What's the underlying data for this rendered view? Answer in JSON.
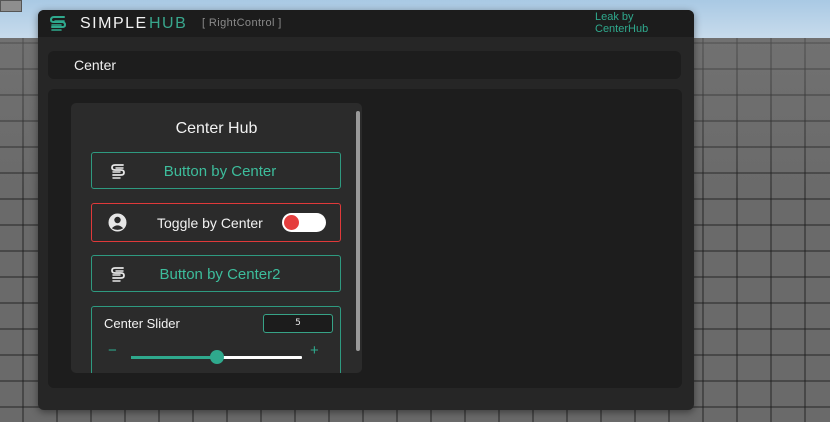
{
  "app": {
    "title_part1": "SIMPLE",
    "title_part2": "HUB",
    "keybind_hint": "[ RightControl ]",
    "credit_line1": "Leak by",
    "credit_line2": "CenterHub"
  },
  "tabs": [
    {
      "label": "Center"
    }
  ],
  "section": {
    "title": "Center Hub",
    "button1_label": "Button by Center",
    "toggle_label": "Toggle by Center",
    "toggle_on": false,
    "button2_label": "Button by Center2",
    "slider": {
      "label": "Center Slider",
      "value": "5",
      "min": 0,
      "max": 10,
      "fraction": 0.5,
      "minus_symbol": "−",
      "plus_symbol": "+"
    }
  },
  "colors": {
    "accent": "#2fa98d",
    "toggle_border": "#e0393a",
    "toggle_knob": "#e53e3e",
    "panel_bg": "#262626"
  },
  "icons": {
    "logo": "stacked-s-logo-icon",
    "button": "stacked-s-icon",
    "toggle": "user-circle-icon"
  }
}
